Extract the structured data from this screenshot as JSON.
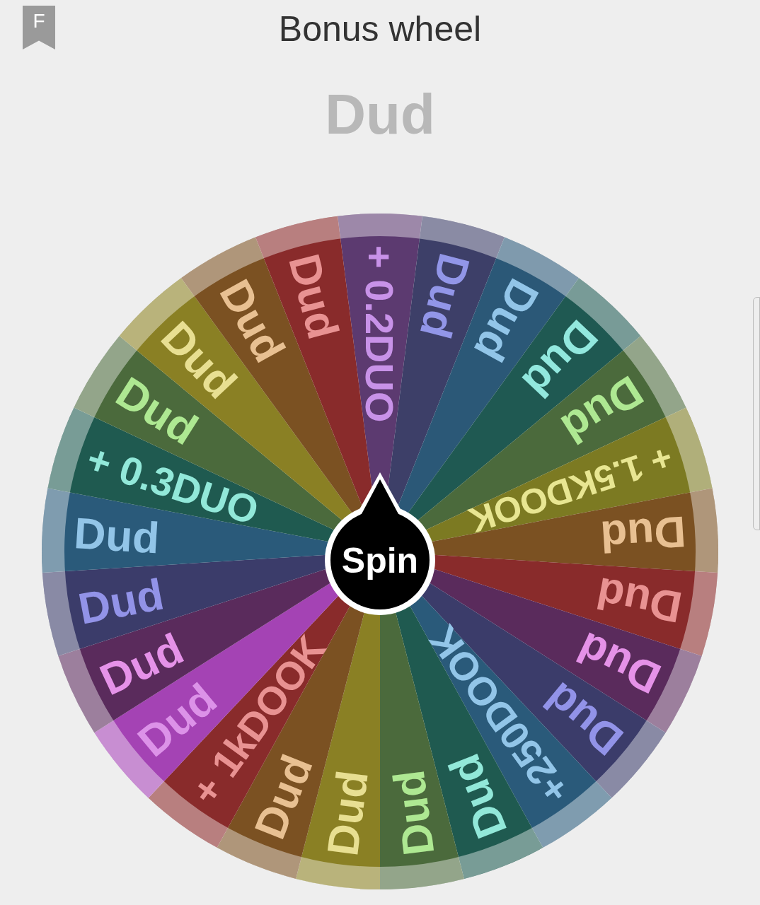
{
  "header": {
    "badge_letter": "F",
    "title": "Bonus wheel"
  },
  "result": "Dud",
  "wheel": {
    "button": "Spin",
    "slices": [
      {
        "color": "#5c3a70",
        "label": "+ 0.2DUO"
      },
      {
        "color": "#3d3f68",
        "label": "Dud"
      },
      {
        "color": "#2b5877",
        "label": "Dud"
      },
      {
        "color": "#1f5952",
        "label": "Dud"
      },
      {
        "color": "#4b6a3c",
        "label": "Dud"
      },
      {
        "color": "#7c7a22",
        "label": "+ 1.5KDOOK"
      },
      {
        "color": "#7b5122",
        "label": "Dud"
      },
      {
        "color": "#892b2b",
        "label": "Dud"
      },
      {
        "color": "#5a2b5c",
        "label": "Dud"
      },
      {
        "color": "#3b3c6a",
        "label": "Dud"
      },
      {
        "color": "#2a5a7a",
        "label": "+250DOOK"
      },
      {
        "color": "#1f5a50",
        "label": "Dud"
      },
      {
        "color": "#4b6a3c",
        "label": "Dud"
      },
      {
        "color": "#8a8024",
        "label": "Dud"
      },
      {
        "color": "#7b5122",
        "label": "Dud"
      },
      {
        "color": "#892b2b",
        "label": "+ 1kDOOK"
      },
      {
        "color": "#a443b4",
        "label": "Dud"
      },
      {
        "color": "#5a2b5c",
        "label": "Dud"
      },
      {
        "color": "#3b3c6a",
        "label": "Dud"
      },
      {
        "color": "#2a5a7a",
        "label": "Dud"
      },
      {
        "color": "#1f5a50",
        "label": "+ 0.3DUO"
      },
      {
        "color": "#4b6a3c",
        "label": "Dud"
      },
      {
        "color": "#8a8024",
        "label": "Dud"
      },
      {
        "color": "#7b5122",
        "label": "Dud"
      },
      {
        "color": "#892b2b",
        "label": "Dud"
      }
    ]
  }
}
